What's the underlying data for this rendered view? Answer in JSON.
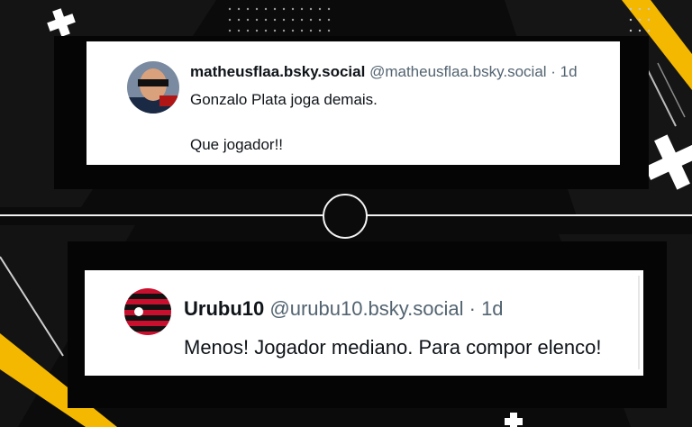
{
  "colors": {
    "background": "#0b0b0b",
    "accent_yellow": "#f5b800",
    "card": "#ffffff",
    "handle_gray": "#536471",
    "text": "#0f1419"
  },
  "posts": [
    {
      "display_name": "matheusflaa.bsky.social",
      "handle_meta": "@matheusflaa.bsky.social · 1d",
      "lines": [
        "Gonzalo Plata joga demais.",
        "Que jogador!!"
      ]
    },
    {
      "display_name": "Urubu10",
      "handle_meta": "@urubu10.bsky.social · 1d",
      "lines": [
        "Menos! Jogador mediano. Para compor elenco!"
      ]
    }
  ],
  "icons": [
    "plus-icon",
    "circle-ring-icon",
    "striped-crest-icon"
  ]
}
